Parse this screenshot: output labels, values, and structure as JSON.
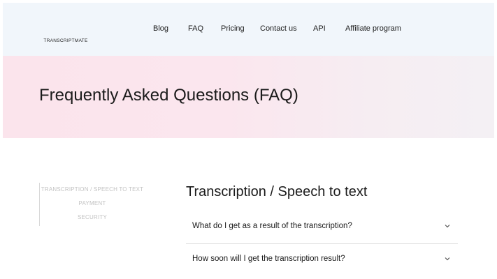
{
  "header": {
    "logo_text": "TRANSCRIPTMATE",
    "nav": [
      {
        "label": "Blog"
      },
      {
        "label": "FAQ"
      },
      {
        "label": "Pricing"
      },
      {
        "label": "Contact us"
      },
      {
        "label": "API"
      },
      {
        "label": "Affiliate program"
      }
    ]
  },
  "hero": {
    "title": "Frequently Asked Questions (FAQ)"
  },
  "side_menu": {
    "items": [
      {
        "label": "TRANSCRIPTION / SPEECH TO TEXT"
      },
      {
        "label": "PAYMENT"
      },
      {
        "label": "SECURITY"
      }
    ]
  },
  "main": {
    "section_title": "Transcription / Speech to text",
    "faqs": [
      {
        "question": "What do I get as a result of the transcription?"
      },
      {
        "question": "How soon will I get the transcription result?"
      }
    ]
  },
  "colors": {
    "header_bg": "#f1f6fb",
    "hero_bg": "#fbe4ec",
    "logo_gradient": [
      "#4a8ff0",
      "#8b5fe0"
    ]
  },
  "icons": {
    "logo": "soundwave-logo-icon",
    "faq_toggle": "chevron-down-icon"
  }
}
